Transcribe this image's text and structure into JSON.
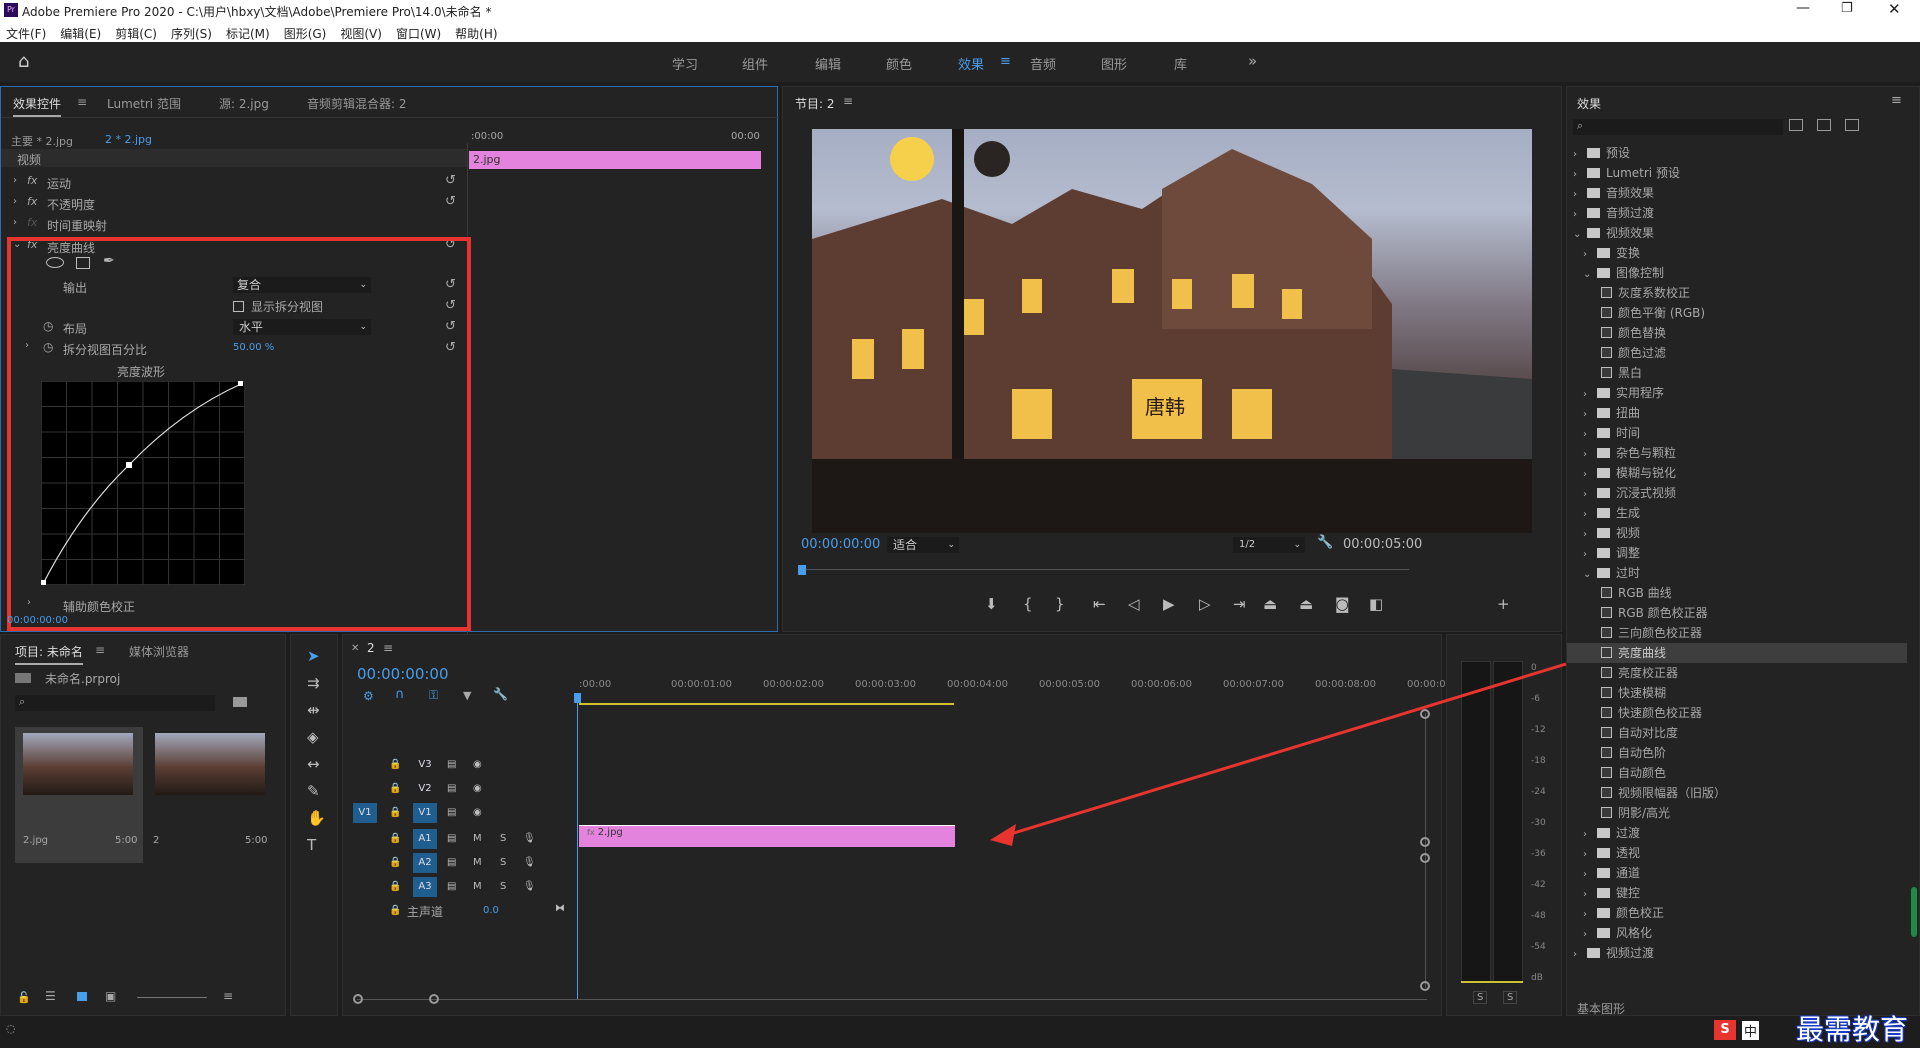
{
  "app": {
    "title": "Adobe Premiere Pro 2020 - C:\\用户\\hbxy\\文档\\Adobe\\Premiere Pro\\14.0\\未命名 *"
  },
  "menu": [
    "文件(F)",
    "编辑(E)",
    "剪辑(C)",
    "序列(S)",
    "标记(M)",
    "图形(G)",
    "视图(V)",
    "窗口(W)",
    "帮助(H)"
  ],
  "workspaces": [
    "学习",
    "组件",
    "编辑",
    "颜色",
    "效果",
    "音频",
    "图形",
    "库"
  ],
  "effect_controls": {
    "tabs": [
      "效果控件",
      "Lumetri 范围",
      "源: 2.jpg",
      "音频剪辑混合器: 2"
    ],
    "master": "主要 * 2.jpg",
    "clip": "2 * 2.jpg",
    "time_start": ":00:00",
    "time_end": "00:00",
    "clip_name": "2.jpg",
    "section": "视频",
    "fx": [
      "运动",
      "不透明度",
      "时间重映射",
      "亮度曲线"
    ],
    "output_label": "输出",
    "output_value": "复合",
    "split_label": "显示拆分视图",
    "layout_label": "布局",
    "layout_value": "水平",
    "split_pct_label": "拆分视图百分比",
    "split_pct_value": "50.00 %",
    "waveform_label": "亮度波形",
    "aux_label": "辅助颜色校正",
    "timecode": "00:00:00:00"
  },
  "program": {
    "title": "节目: 2",
    "timecode": "00:00:00:00",
    "fit": "适合",
    "ratio": "1/2",
    "duration": "00:00:05:00",
    "sign_text": "唐韩"
  },
  "project": {
    "tabs": [
      "项目: 未命名",
      "媒体浏览器"
    ],
    "file": "未命名.prproj",
    "items": [
      {
        "name": "2.jpg",
        "dur": "5:00"
      },
      {
        "name": "2",
        "dur": "5:00"
      }
    ]
  },
  "timeline": {
    "tab": "2",
    "timecode": "00:00:00:00",
    "ruler": [
      ":00:00",
      "00:00:01:00",
      "00:00:02:00",
      "00:00:03:00",
      "00:00:04:00",
      "00:00:05:00",
      "00:00:06:00",
      "00:00:07:00",
      "00:00:08:00",
      "00:00:09:"
    ],
    "tracks": [
      "V3",
      "V2",
      "V1",
      "A1",
      "A2",
      "A3"
    ],
    "source_v1": "V1",
    "master": "主声道",
    "master_val": "0.0",
    "clip": "2.jpg"
  },
  "meter": {
    "ticks": [
      "0",
      "-6",
      "-12",
      "-18",
      "-24",
      "-30",
      "-36",
      "-42",
      "-48",
      "-54",
      "dB"
    ],
    "solo": [
      "S",
      "S"
    ]
  },
  "effects": {
    "title": "效果",
    "tree": [
      {
        "l": "预设",
        "d": 0,
        "t": "f",
        "o": false
      },
      {
        "l": "Lumetri 预设",
        "d": 0,
        "t": "f",
        "o": false
      },
      {
        "l": "音频效果",
        "d": 0,
        "t": "f",
        "o": false
      },
      {
        "l": "音频过渡",
        "d": 0,
        "t": "f",
        "o": false
      },
      {
        "l": "视频效果",
        "d": 0,
        "t": "f",
        "o": true
      },
      {
        "l": "变换",
        "d": 1,
        "t": "f",
        "o": false
      },
      {
        "l": "图像控制",
        "d": 1,
        "t": "f",
        "o": true
      },
      {
        "l": "灰度系数校正",
        "d": 2,
        "t": "e"
      },
      {
        "l": "颜色平衡 (RGB)",
        "d": 2,
        "t": "e"
      },
      {
        "l": "颜色替换",
        "d": 2,
        "t": "e"
      },
      {
        "l": "颜色过滤",
        "d": 2,
        "t": "e"
      },
      {
        "l": "黑白",
        "d": 2,
        "t": "e"
      },
      {
        "l": "实用程序",
        "d": 1,
        "t": "f",
        "o": false
      },
      {
        "l": "扭曲",
        "d": 1,
        "t": "f",
        "o": false
      },
      {
        "l": "时间",
        "d": 1,
        "t": "f",
        "o": false
      },
      {
        "l": "杂色与颗粒",
        "d": 1,
        "t": "f",
        "o": false
      },
      {
        "l": "模糊与锐化",
        "d": 1,
        "t": "f",
        "o": false
      },
      {
        "l": "沉浸式视频",
        "d": 1,
        "t": "f",
        "o": false
      },
      {
        "l": "生成",
        "d": 1,
        "t": "f",
        "o": false
      },
      {
        "l": "视频",
        "d": 1,
        "t": "f",
        "o": false
      },
      {
        "l": "调整",
        "d": 1,
        "t": "f",
        "o": false
      },
      {
        "l": "过时",
        "d": 1,
        "t": "f",
        "o": true
      },
      {
        "l": "RGB 曲线",
        "d": 2,
        "t": "e"
      },
      {
        "l": "RGB 颜色校正器",
        "d": 2,
        "t": "e"
      },
      {
        "l": "三向颜色校正器",
        "d": 2,
        "t": "e"
      },
      {
        "l": "亮度曲线",
        "d": 2,
        "t": "e",
        "sel": true
      },
      {
        "l": "亮度校正器",
        "d": 2,
        "t": "e"
      },
      {
        "l": "快速模糊",
        "d": 2,
        "t": "e"
      },
      {
        "l": "快速颜色校正器",
        "d": 2,
        "t": "e"
      },
      {
        "l": "自动对比度",
        "d": 2,
        "t": "e"
      },
      {
        "l": "自动色阶",
        "d": 2,
        "t": "e"
      },
      {
        "l": "自动颜色",
        "d": 2,
        "t": "e"
      },
      {
        "l": "视频限幅器（旧版）",
        "d": 2,
        "t": "e"
      },
      {
        "l": "阴影/高光",
        "d": 2,
        "t": "e"
      },
      {
        "l": "过渡",
        "d": 1,
        "t": "f",
        "o": false
      },
      {
        "l": "透视",
        "d": 1,
        "t": "f",
        "o": false
      },
      {
        "l": "通道",
        "d": 1,
        "t": "f",
        "o": false
      },
      {
        "l": "键控",
        "d": 1,
        "t": "f",
        "o": false
      },
      {
        "l": "颜色校正",
        "d": 1,
        "t": "f",
        "o": false
      },
      {
        "l": "风格化",
        "d": 1,
        "t": "f",
        "o": false
      },
      {
        "l": "视频过渡",
        "d": 0,
        "t": "f",
        "o": false
      }
    ],
    "footer": "基本图形"
  },
  "watermark": "最需教育",
  "ime": "中"
}
